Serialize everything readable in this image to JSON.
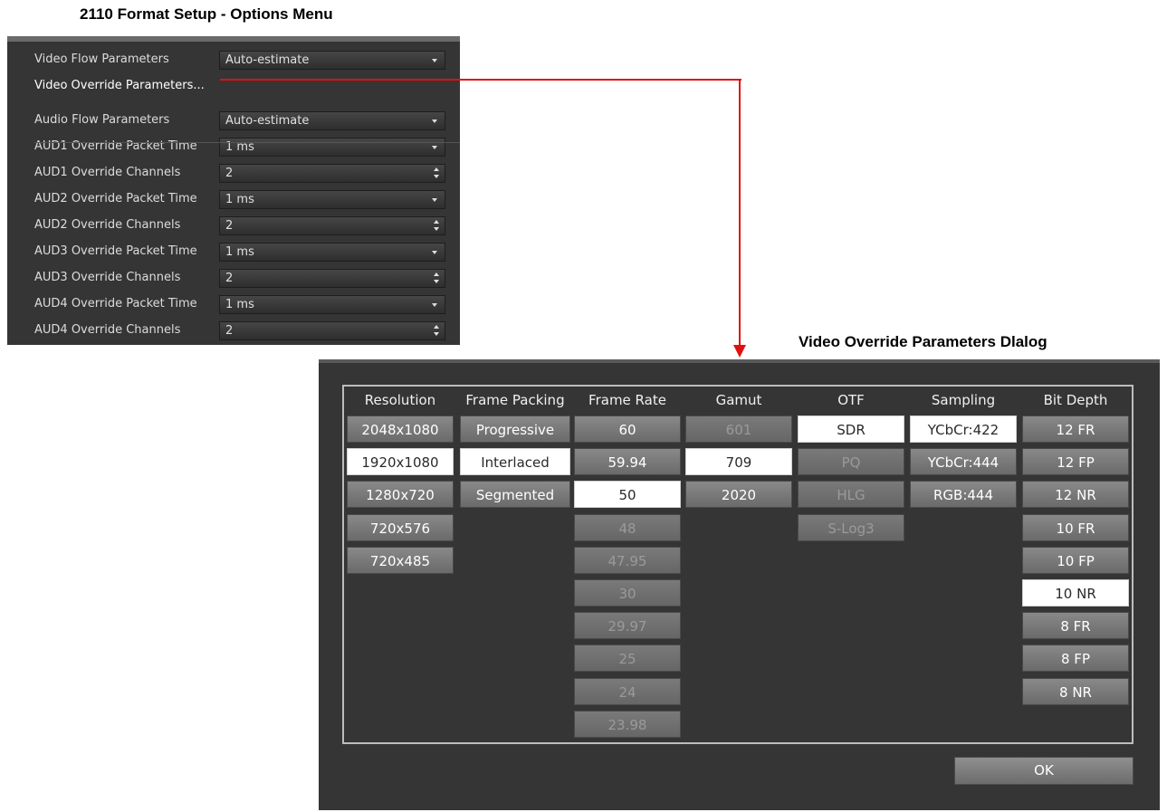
{
  "captions": {
    "menu": "2110 Format Setup - Options Menu",
    "dialog": "Video Override Parameters Dlalog"
  },
  "menu": {
    "rows": [
      {
        "label": "Video Flow Parameters",
        "control": "dropdown",
        "value": "Auto-estimate"
      },
      {
        "label": "Video Override Parameters...",
        "control": "link"
      },
      {
        "label": "Audio Flow Parameters",
        "control": "dropdown",
        "value": "Auto-estimate"
      },
      {
        "label": "AUD1 Override Packet Time",
        "control": "dropdown",
        "value": "1 ms"
      },
      {
        "label": "AUD1 Override Channels",
        "control": "spinbox",
        "value": "2"
      },
      {
        "label": "AUD2 Override Packet Time",
        "control": "dropdown",
        "value": "1 ms"
      },
      {
        "label": "AUD2 Override Channels",
        "control": "spinbox",
        "value": "2"
      },
      {
        "label": "AUD3 Override Packet Time",
        "control": "dropdown",
        "value": "1 ms"
      },
      {
        "label": "AUD3 Override Channels",
        "control": "spinbox",
        "value": "2"
      },
      {
        "label": "AUD4 Override Packet Time",
        "control": "dropdown",
        "value": "1 ms"
      },
      {
        "label": "AUD4 Override Channels",
        "control": "spinbox",
        "value": "2"
      }
    ]
  },
  "dialog": {
    "columns": [
      {
        "header": "Resolution",
        "options": [
          {
            "label": "2048x1080",
            "state": "normal"
          },
          {
            "label": "1920x1080",
            "state": "selected"
          },
          {
            "label": "1280x720",
            "state": "normal"
          },
          {
            "label": "720x576",
            "state": "normal"
          },
          {
            "label": "720x485",
            "state": "normal"
          }
        ]
      },
      {
        "header": "Frame Packing",
        "options": [
          {
            "label": "Progressive",
            "state": "normal"
          },
          {
            "label": "Interlaced",
            "state": "selected"
          },
          {
            "label": "Segmented",
            "state": "normal"
          }
        ]
      },
      {
        "header": "Frame Rate",
        "options": [
          {
            "label": "60",
            "state": "normal"
          },
          {
            "label": "59.94",
            "state": "normal"
          },
          {
            "label": "50",
            "state": "selected"
          },
          {
            "label": "48",
            "state": "disabled"
          },
          {
            "label": "47.95",
            "state": "disabled"
          },
          {
            "label": "30",
            "state": "disabled"
          },
          {
            "label": "29.97",
            "state": "disabled"
          },
          {
            "label": "25",
            "state": "disabled"
          },
          {
            "label": "24",
            "state": "disabled"
          },
          {
            "label": "23.98",
            "state": "disabled"
          }
        ]
      },
      {
        "header": "Gamut",
        "options": [
          {
            "label": "601",
            "state": "disabled"
          },
          {
            "label": "709",
            "state": "selected"
          },
          {
            "label": "2020",
            "state": "normal"
          }
        ]
      },
      {
        "header": "OTF",
        "options": [
          {
            "label": "SDR",
            "state": "selected"
          },
          {
            "label": "PQ",
            "state": "disabled"
          },
          {
            "label": "HLG",
            "state": "disabled"
          },
          {
            "label": "S-Log3",
            "state": "disabled"
          }
        ]
      },
      {
        "header": "Sampling",
        "options": [
          {
            "label": "YCbCr:422",
            "state": "selected"
          },
          {
            "label": "YCbCr:444",
            "state": "normal"
          },
          {
            "label": "RGB:444",
            "state": "normal"
          }
        ]
      },
      {
        "header": "Bit Depth",
        "options": [
          {
            "label": "12 FR",
            "state": "normal"
          },
          {
            "label": "12 FP",
            "state": "normal"
          },
          {
            "label": "12 NR",
            "state": "normal"
          },
          {
            "label": "10 FR",
            "state": "normal"
          },
          {
            "label": "10 FP",
            "state": "normal"
          },
          {
            "label": "10 NR",
            "state": "selected"
          },
          {
            "label": "8 FR",
            "state": "normal"
          },
          {
            "label": "8 FP",
            "state": "normal"
          },
          {
            "label": "8 NR",
            "state": "normal"
          }
        ]
      }
    ],
    "ok_label": "OK"
  },
  "colors": {
    "panel": "#353535",
    "button": "#7a7a7a",
    "selected": "#ffffff",
    "connector": "#e01010"
  }
}
